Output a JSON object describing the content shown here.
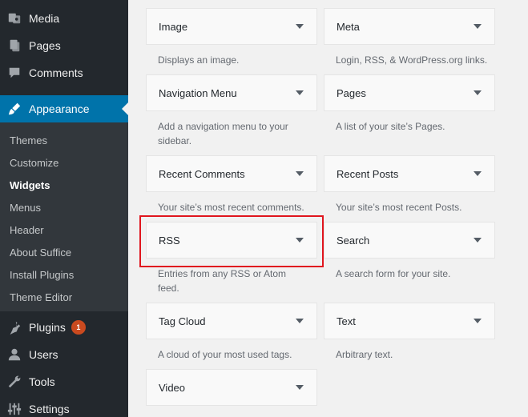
{
  "sidebar": {
    "menu": [
      {
        "label": "Media",
        "icon": "media-icon"
      },
      {
        "label": "Pages",
        "icon": "pages-icon"
      },
      {
        "label": "Comments",
        "icon": "comments-icon"
      },
      {
        "label": "Appearance",
        "icon": "appearance-brush-icon",
        "current": true
      },
      {
        "label": "Plugins",
        "icon": "plugins-icon",
        "badge": "1"
      },
      {
        "label": "Users",
        "icon": "users-icon"
      },
      {
        "label": "Tools",
        "icon": "tools-wrench-icon"
      },
      {
        "label": "Settings",
        "icon": "settings-sliders-icon"
      }
    ],
    "submenu": [
      {
        "label": "Themes"
      },
      {
        "label": "Customize"
      },
      {
        "label": "Widgets",
        "current": true
      },
      {
        "label": "Menus"
      },
      {
        "label": "Header"
      },
      {
        "label": "About Suffice"
      },
      {
        "label": "Install Plugins"
      },
      {
        "label": "Theme Editor"
      }
    ]
  },
  "widgets": [
    {
      "title": "Image",
      "desc": "Displays an image."
    },
    {
      "title": "Meta",
      "desc": "Login, RSS, & WordPress.org links."
    },
    {
      "title": "Navigation Menu",
      "desc": "Add a navigation menu to your sidebar."
    },
    {
      "title": "Pages",
      "desc": "A list of your site’s Pages."
    },
    {
      "title": "Recent Comments",
      "desc": "Your site’s most recent comments."
    },
    {
      "title": "Recent Posts",
      "desc": "Your site’s most recent Posts."
    },
    {
      "title": "RSS",
      "desc": "Entries from any RSS or Atom feed."
    },
    {
      "title": "Search",
      "desc": "A search form for your site."
    },
    {
      "title": "Tag Cloud",
      "desc": "A cloud of your most used tags."
    },
    {
      "title": "Text",
      "desc": "Arbitrary text."
    },
    {
      "title": "Video",
      "desc": ""
    }
  ],
  "colors": {
    "sidebar_bg": "#23282d",
    "submenu_bg": "#32373c",
    "accent": "#0073aa",
    "badge": "#ca4a1f",
    "highlight": "#e0161e"
  }
}
